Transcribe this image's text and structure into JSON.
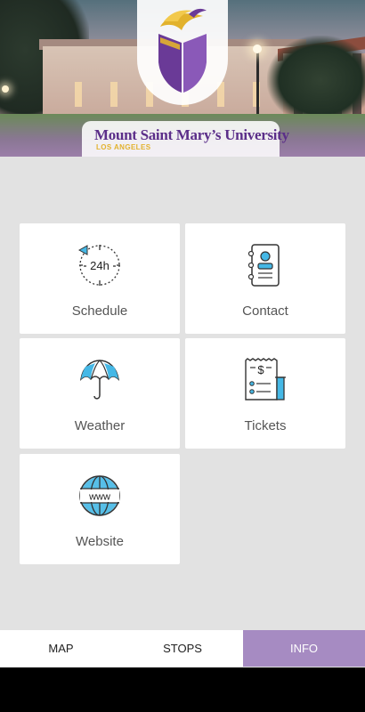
{
  "header": {
    "university_name": "Mount Saint Mary’s University",
    "university_location": "LOS ANGELES",
    "logo_icon": "university-crest-book-flame-icon",
    "colors": {
      "purple": "#5b2e89",
      "gold": "#e2b22d"
    }
  },
  "tiles": [
    {
      "label": "Schedule",
      "icon": "clock-24h-icon"
    },
    {
      "label": "Contact",
      "icon": "contact-card-icon"
    },
    {
      "label": "Weather",
      "icon": "umbrella-icon"
    },
    {
      "label": "Tickets",
      "icon": "receipt-ticket-icon"
    },
    {
      "label": "Website",
      "icon": "globe-www-icon"
    }
  ],
  "bottom_nav": {
    "tabs": [
      {
        "label": "MAP",
        "active": false
      },
      {
        "label": "STOPS",
        "active": false
      },
      {
        "label": "INFO",
        "active": true
      }
    ],
    "active_color": "#a68bc2"
  }
}
